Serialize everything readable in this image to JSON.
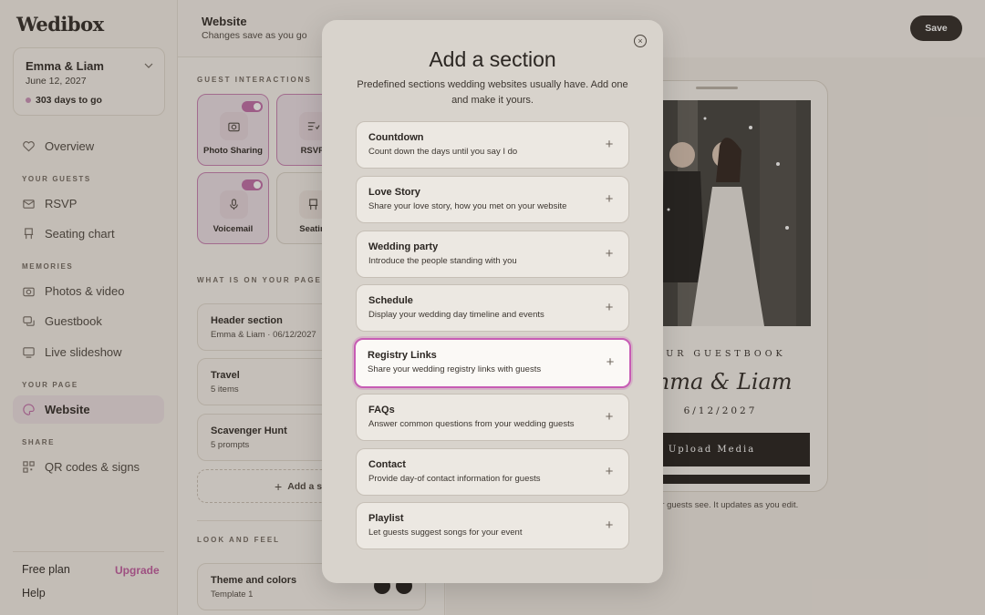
{
  "sidebar": {
    "logo": "Wedibox",
    "event": {
      "name": "Emma & Liam",
      "date": "June 12, 2027",
      "countdown": "303 days to go"
    },
    "overview": "Overview",
    "sections": {
      "guests": "YOUR GUESTS",
      "memories": "MEMORIES",
      "page": "YOUR PAGE",
      "share": "SHARE"
    },
    "items": {
      "rsvp": "RSVP",
      "seating": "Seating chart",
      "photos": "Photos & video",
      "guestbook": "Guestbook",
      "slideshow": "Live slideshow",
      "website": "Website",
      "qr": "QR codes & signs"
    },
    "plan": "Free plan",
    "upgrade": "Upgrade",
    "help": "Help"
  },
  "header": {
    "title": "Website",
    "subtitle": "Changes save as you go",
    "save": "Save"
  },
  "editor": {
    "guest_interactions_label": "GUEST INTERACTIONS",
    "tiles": [
      {
        "label": "Photo Sharing",
        "on": true,
        "icon": "camera-icon"
      },
      {
        "label": "RSVP",
        "on": false,
        "icon": "rsvp-icon"
      },
      {
        "label": "Voicemail",
        "on": true,
        "icon": "microphone-icon"
      },
      {
        "label": "Seatin",
        "on": false,
        "icon": "seat-icon"
      }
    ],
    "on_page_label": "WHAT IS ON YOUR PAGE",
    "cards": [
      {
        "title": "Header section",
        "sub": "Emma & Liam · 06/12/2027"
      },
      {
        "title": "Travel",
        "sub": "5 items"
      },
      {
        "title": "Scavenger Hunt",
        "sub": "5 prompts"
      }
    ],
    "add_section": "Add a s",
    "look_label": "LOOK AND FEEL",
    "theme": {
      "title": "Theme and colors",
      "sub": "Template 1"
    }
  },
  "preview": {
    "guestbook_title": "OUR GUESTBOOK",
    "names": "mma & Liam",
    "date": "6/12/2027",
    "upload": "Upload Media",
    "caption": "ur guests see. It updates as you edit."
  },
  "modal": {
    "title": "Add a section",
    "description": "Predefined sections wedding websites usually have. Add one and make it yours.",
    "options": [
      {
        "title": "Countdown",
        "sub": "Count down the days until you say I do"
      },
      {
        "title": "Love Story",
        "sub": "Share your love story, how you met on your website"
      },
      {
        "title": "Wedding party",
        "sub": "Introduce the people standing with you"
      },
      {
        "title": "Schedule",
        "sub": "Display your wedding day timeline and events"
      },
      {
        "title": "Registry Links",
        "sub": "Share your wedding registry links with guests",
        "highlighted": true
      },
      {
        "title": "FAQs",
        "sub": "Answer common questions from your wedding guests"
      },
      {
        "title": "Contact",
        "sub": "Provide day-of contact information for guests"
      },
      {
        "title": "Playlist",
        "sub": "Let guests suggest songs for your event"
      }
    ]
  },
  "colors": {
    "accent": "#c75cb4",
    "dark": "#2b2622",
    "upgrade": "#c1589f"
  }
}
